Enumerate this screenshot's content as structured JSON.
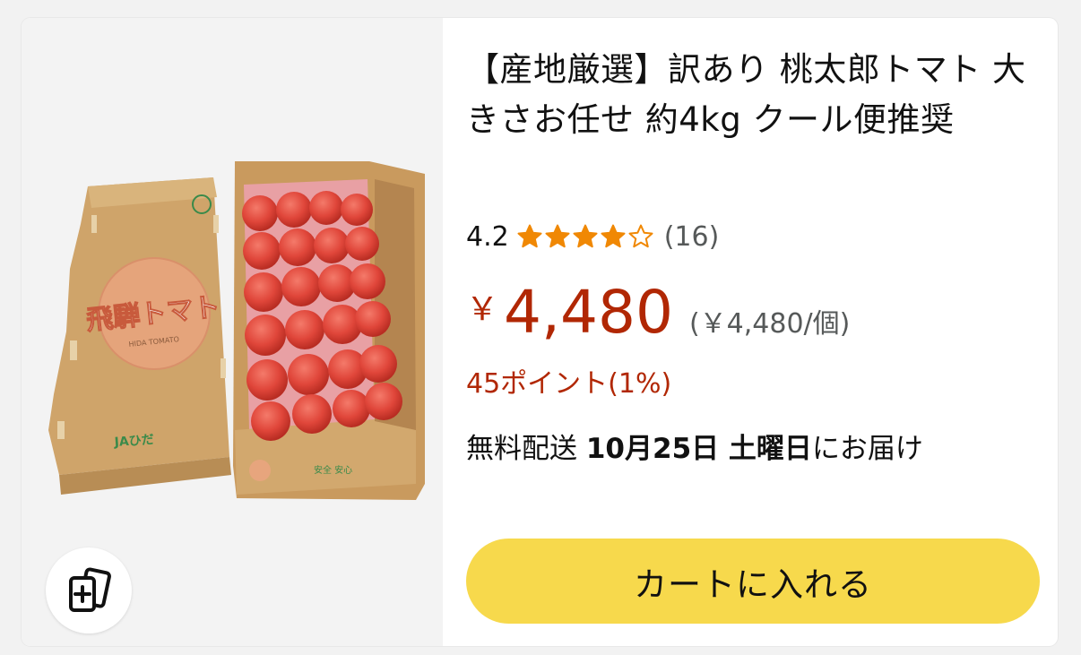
{
  "product": {
    "title": "【産地厳選】訳あり 桃太郎トマト 大きさお任せ 約4kg クール便推奨",
    "image": {
      "box_brand": "飛騨トマト",
      "box_sub": "HIDA TOMATO",
      "box_maker": "JAひだ",
      "box_maker2": "安全 安心"
    },
    "rating": {
      "value": "4.2",
      "stars": 4.2,
      "max_stars": 5,
      "count": "(16)",
      "star_color": "#f08804"
    },
    "price": {
      "symbol": "￥",
      "amount": "4,480",
      "unit_price": "(￥4,480/個)",
      "color": "#b12704"
    },
    "points": "45ポイント(1%)",
    "delivery": {
      "prefix": "無料配送 ",
      "date": "10月25日 土曜日",
      "suffix": "にお届け"
    },
    "cart_button_label": "カートに入れる",
    "cart_button_color": "#f7d94c",
    "compare_icon": "add-to-compare-icon"
  }
}
